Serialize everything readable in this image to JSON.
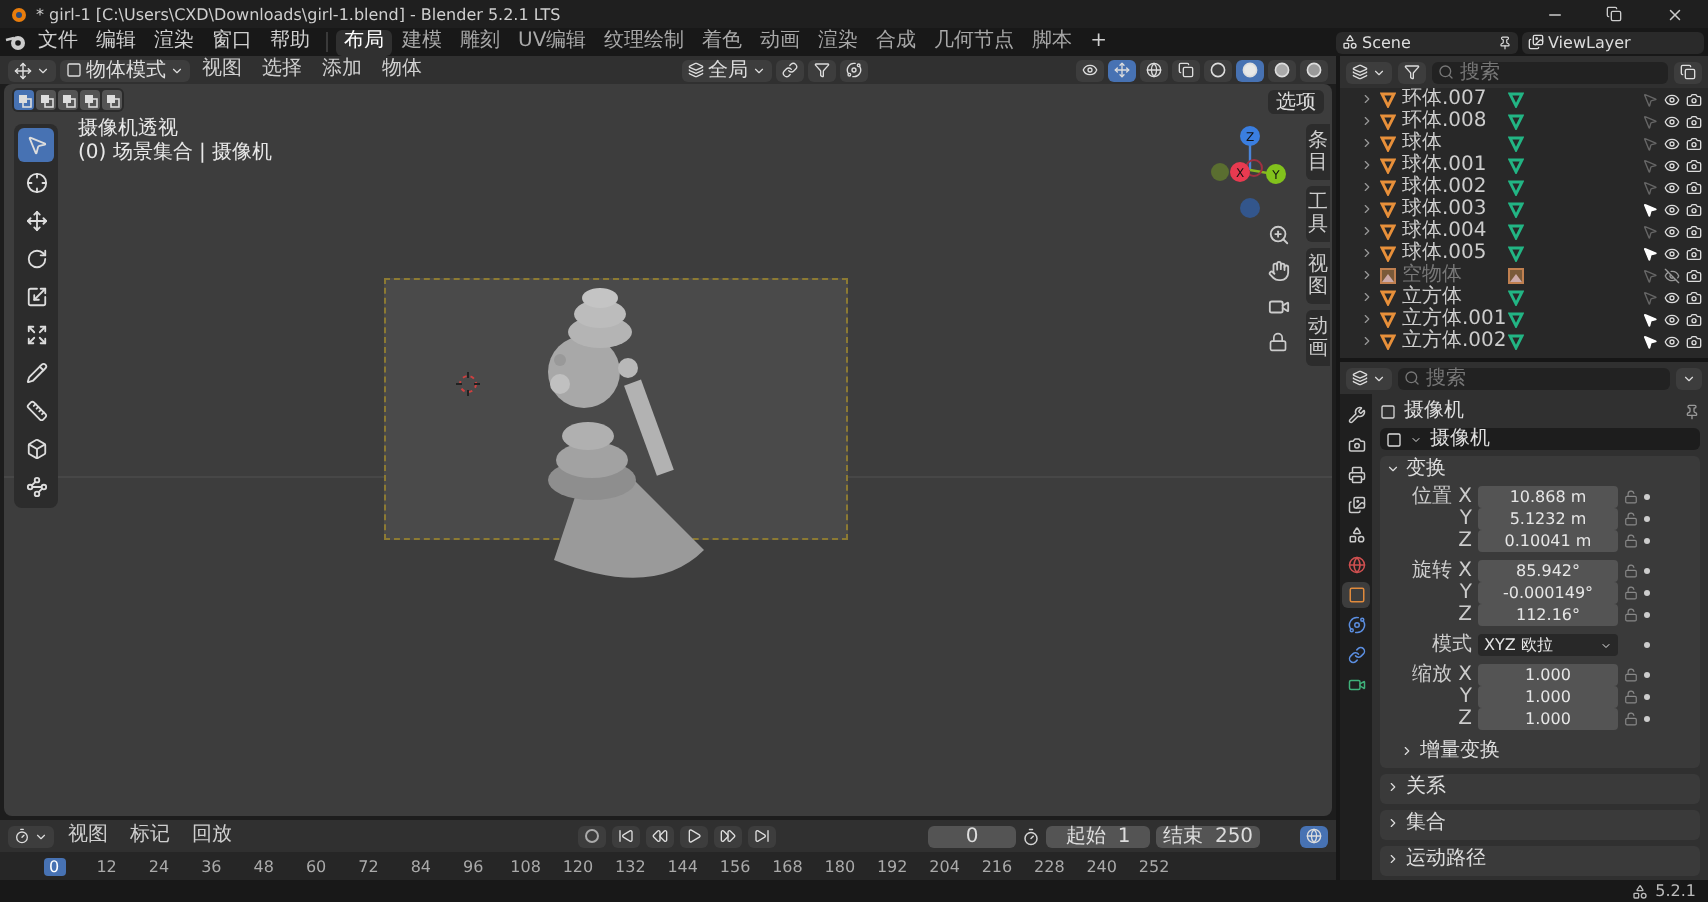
{
  "window": {
    "title": "* girl-1 [C:\\Users\\CXD\\Downloads\\girl-1.blend] - Blender 5.2.1 LTS"
  },
  "menu": [
    "文件",
    "编辑",
    "渲染",
    "窗口",
    "帮助"
  ],
  "workspaces": [
    {
      "label": "布局",
      "selected": true
    },
    {
      "label": "建模",
      "selected": false
    },
    {
      "label": "雕刻",
      "selected": false
    },
    {
      "label": "UV编辑",
      "selected": false
    },
    {
      "label": "纹理绘制",
      "selected": false
    },
    {
      "label": "着色",
      "selected": false
    },
    {
      "label": "动画",
      "selected": false
    },
    {
      "label": "渲染",
      "selected": false
    },
    {
      "label": "合成",
      "selected": false
    },
    {
      "label": "几何节点",
      "selected": false
    },
    {
      "label": "脚本",
      "selected": false
    }
  ],
  "add_workspace": "+",
  "scene": "Scene",
  "view_layer": "ViewLayer",
  "viewport": {
    "mode": "物体模式",
    "menus": [
      "视图",
      "选择",
      "添加",
      "物体"
    ],
    "orientation": "全局",
    "options": "选项",
    "shading_modes": [
      {
        "kind": "wireframe",
        "selected": false
      },
      {
        "kind": "solid",
        "selected": true
      },
      {
        "kind": "material",
        "selected": false
      },
      {
        "kind": "rendered",
        "selected": false
      }
    ],
    "select_modes": [
      {
        "selected": true
      },
      {
        "selected": false
      },
      {
        "selected": false
      },
      {
        "selected": false
      },
      {
        "selected": false
      }
    ],
    "overlay_title": "摄像机透视",
    "overlay_subtitle": "(0) 场景集合 | 摄像机",
    "gizmo": {
      "x": "X",
      "y": "Y",
      "z": "Z"
    },
    "sidebar_tabs": [
      "条目",
      "工具",
      "视图",
      "动画"
    ],
    "tools": [
      {
        "kind": "select",
        "selected": true
      },
      {
        "kind": "cursor",
        "selected": false
      },
      {
        "kind": "move",
        "selected": false
      },
      {
        "kind": "rotate",
        "selected": false
      },
      {
        "kind": "scale",
        "selected": false
      },
      {
        "kind": "transform",
        "selected": false
      },
      {
        "kind": "annotate",
        "selected": false
      },
      {
        "kind": "measure",
        "selected": false
      },
      {
        "kind": "add_cube",
        "selected": false
      },
      {
        "kind": "curve",
        "selected": false
      }
    ]
  },
  "timeline": {
    "menus": [
      "视图",
      "标记",
      "回放"
    ],
    "current_frame": "0",
    "start_label": "起始",
    "start": "1",
    "end_label": "结束",
    "end": "250",
    "ruler": [
      {
        "label": "0",
        "selected": true
      },
      {
        "label": "12",
        "selected": false
      },
      {
        "label": "24",
        "selected": false
      },
      {
        "label": "36",
        "selected": false
      },
      {
        "label": "48",
        "selected": false
      },
      {
        "label": "60",
        "selected": false
      },
      {
        "label": "72",
        "selected": false
      },
      {
        "label": "84",
        "selected": false
      },
      {
        "label": "96",
        "selected": false
      },
      {
        "label": "108",
        "selected": false
      },
      {
        "label": "120",
        "selected": false
      },
      {
        "label": "132",
        "selected": false
      },
      {
        "label": "144",
        "selected": false
      },
      {
        "label": "156",
        "selected": false
      },
      {
        "label": "168",
        "selected": false
      },
      {
        "label": "180",
        "selected": false
      },
      {
        "label": "192",
        "selected": false
      },
      {
        "label": "204",
        "selected": false
      },
      {
        "label": "216",
        "selected": false
      },
      {
        "label": "228",
        "selected": false
      },
      {
        "label": "240",
        "selected": false
      },
      {
        "label": "252",
        "selected": false
      }
    ]
  },
  "outliner": {
    "search_placeholder": "搜索",
    "rows": [
      {
        "name": "环体.007",
        "kind": "mesh",
        "selected": false,
        "hidden": false
      },
      {
        "name": "环体.008",
        "kind": "mesh",
        "selected": false,
        "hidden": false
      },
      {
        "name": "球体",
        "kind": "mesh",
        "selected": false,
        "hidden": false
      },
      {
        "name": "球体.001",
        "kind": "mesh",
        "selected": false,
        "hidden": false
      },
      {
        "name": "球体.002",
        "kind": "mesh",
        "selected": false,
        "hidden": false
      },
      {
        "name": "球体.003",
        "kind": "mesh",
        "selected": true,
        "hidden": false
      },
      {
        "name": "球体.004",
        "kind": "mesh",
        "selected": false,
        "hidden": false
      },
      {
        "name": "球体.005",
        "kind": "mesh",
        "selected": true,
        "hidden": false
      },
      {
        "name": "空物体",
        "kind": "image",
        "selected": false,
        "hidden": true
      },
      {
        "name": "立方体",
        "kind": "mesh",
        "selected": false,
        "hidden": false
      },
      {
        "name": "立方体.001",
        "kind": "mesh",
        "selected": true,
        "hidden": false
      },
      {
        "name": "立方体.002",
        "kind": "mesh",
        "selected": true,
        "hidden": false
      }
    ]
  },
  "properties": {
    "search_placeholder": "搜索",
    "object_name": "摄像机",
    "data_name": "摄像机",
    "tabs": [
      {
        "kind": "tool",
        "selected": false
      },
      {
        "kind": "render",
        "selected": false
      },
      {
        "kind": "output",
        "selected": false
      },
      {
        "kind": "view_layer",
        "selected": false
      },
      {
        "kind": "scene",
        "selected": false
      },
      {
        "kind": "world",
        "selected": false
      },
      {
        "kind": "object",
        "selected": true
      },
      {
        "kind": "physics",
        "selected": false
      },
      {
        "kind": "constraints",
        "selected": false
      },
      {
        "kind": "data",
        "selected": false
      }
    ],
    "transform": {
      "title": "变换",
      "expanded": true,
      "groups": [
        {
          "rows": [
            {
              "label": "位置 X",
              "value": "10.868 m",
              "kind": "number"
            },
            {
              "label": "Y",
              "value": "5.1232 m",
              "kind": "number"
            },
            {
              "label": "Z",
              "value": "0.10041 m",
              "kind": "number"
            }
          ]
        },
        {
          "rows": [
            {
              "label": "旋转 X",
              "value": "85.942°",
              "kind": "number"
            },
            {
              "label": "Y",
              "value": "-0.000149°",
              "kind": "number"
            },
            {
              "label": "Z",
              "value": "112.16°",
              "kind": "number"
            }
          ]
        },
        {
          "rows": [
            {
              "label": "模式",
              "value": "XYZ 欧拉",
              "kind": "dropdown"
            }
          ]
        },
        {
          "rows": [
            {
              "label": "缩放 X",
              "value": "1.000",
              "kind": "number"
            },
            {
              "label": "Y",
              "value": "1.000",
              "kind": "number"
            },
            {
              "label": "Z",
              "value": "1.000",
              "kind": "number"
            }
          ]
        }
      ],
      "subpanel": {
        "title": "增量变换",
        "expanded": false
      }
    },
    "panels": [
      {
        "title": "关系",
        "expanded": false
      },
      {
        "title": "集合",
        "expanded": false
      },
      {
        "title": "运动路径",
        "expanded": false
      }
    ]
  },
  "status_bar": {
    "version": "5.2.1"
  }
}
